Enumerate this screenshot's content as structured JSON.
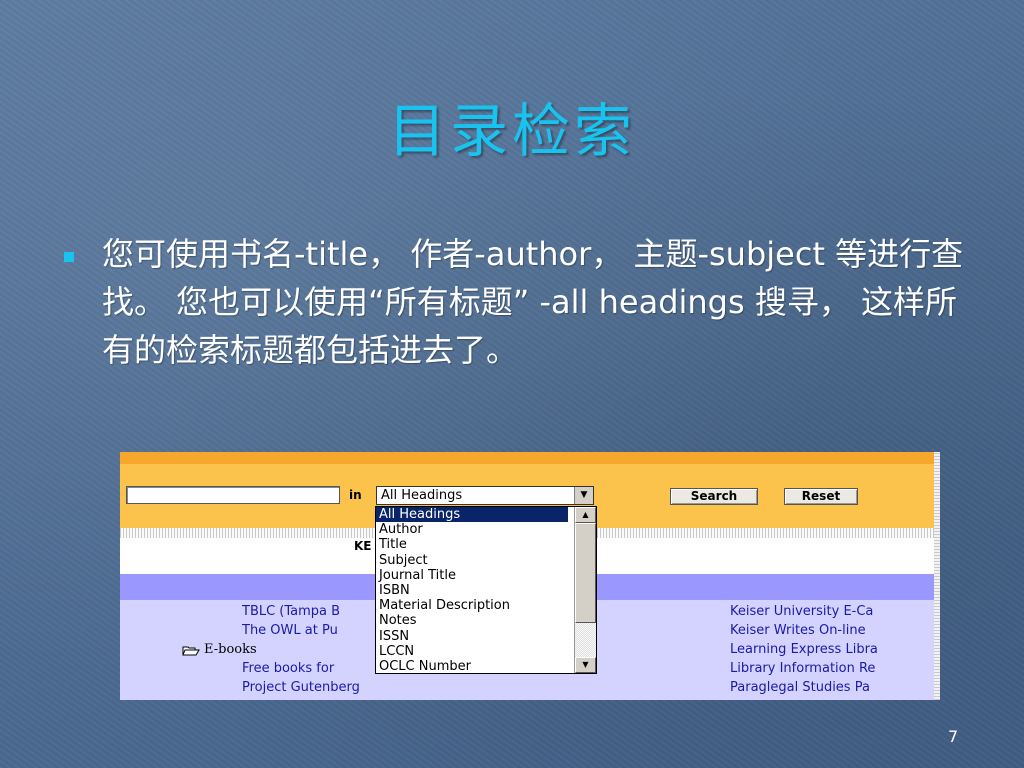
{
  "slide": {
    "title": "目录检索",
    "body": "您可使用书名-title， 作者-author， 主题-subject 等进行查找。 您也可以使用“所有标题” -all headings 搜寻， 这样所有的检索标题都包括进去了。",
    "page_number": "7",
    "accent_color": "#19c3ef"
  },
  "screenshot": {
    "search_input_value": "",
    "in_label": "in",
    "select_value": "All Headings",
    "search_button": "Search",
    "reset_button": "Reset",
    "partial_label": "KE",
    "dropdown_options": [
      "All Headings",
      "Author",
      "Title",
      "Subject",
      "Journal Title",
      "ISBN",
      "Material Description",
      "Notes",
      "ISSN",
      "LCCN",
      "OCLC Number"
    ],
    "left_links": [
      "TBLC (Tampa B",
      "The OWL at Pu",
      "Free books for",
      "Project Gutenberg"
    ],
    "ebooks_label": "E-books",
    "right_links": [
      "Keiser University E-Ca",
      "Keiser Writes On-line",
      "Learning Express Libra",
      "Library Information Re",
      "Paraglegal Studies Pa"
    ],
    "colors": {
      "header_orange": "#fbc24c",
      "purple_bar": "#9a97ff",
      "list_background": "#d4d3ff",
      "link_color": "#1a1aa8",
      "selected_option": "#0a246a"
    }
  }
}
